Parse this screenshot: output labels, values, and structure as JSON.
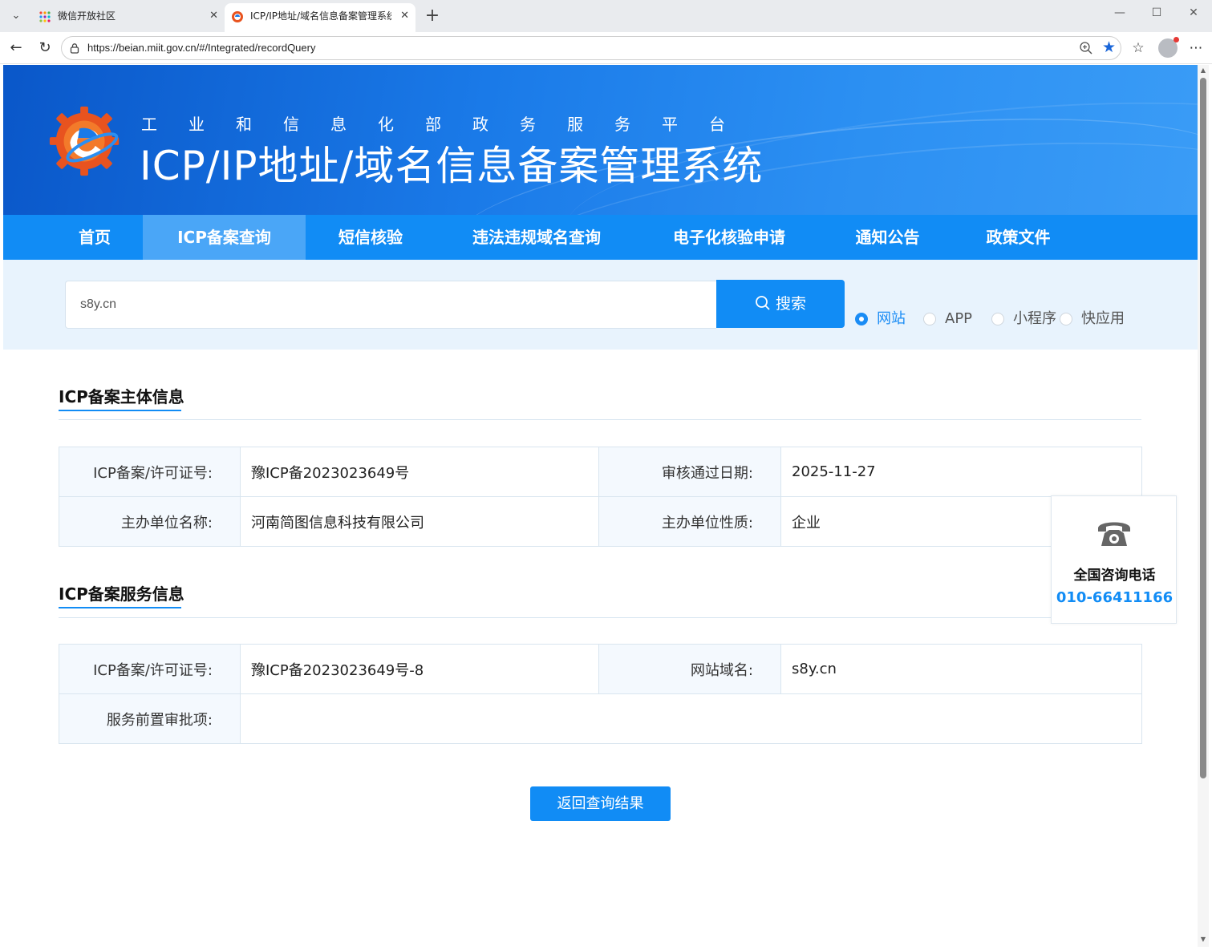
{
  "browser": {
    "tabs": [
      {
        "title": "微信开放社区",
        "active": false
      },
      {
        "title": "ICP/IP地址/域名信息备案管理系统",
        "active": true
      }
    ],
    "url": "https://beian.miit.gov.cn/#/Integrated/recordQuery"
  },
  "header": {
    "subtitle": "工业和信息化部政务服务平台",
    "title": "ICP/IP地址/域名信息备案管理系统"
  },
  "menu": {
    "items": [
      {
        "label": "首页",
        "active": false
      },
      {
        "label": "ICP备案查询",
        "active": true
      },
      {
        "label": "短信核验",
        "active": false
      },
      {
        "label": "违法违规域名查询",
        "active": false
      },
      {
        "label": "电子化核验申请",
        "active": false
      },
      {
        "label": "通知公告",
        "active": false
      },
      {
        "label": "政策文件",
        "active": false
      }
    ]
  },
  "search": {
    "value": "s8y.cn",
    "button_label": "搜索",
    "types": [
      {
        "label": "网站",
        "checked": true
      },
      {
        "label": "APP",
        "checked": false
      },
      {
        "label": "小程序",
        "checked": false
      },
      {
        "label": "快应用",
        "checked": false
      }
    ]
  },
  "subject_info": {
    "title": "ICP备案主体信息",
    "license_label": "ICP备案/许可证号:",
    "license_value": "豫ICP备2023023649号",
    "approve_date_label": "审核通过日期:",
    "approve_date_value": "2025-11-27",
    "org_name_label": "主办单位名称:",
    "org_name_value": "河南简图信息科技有限公司",
    "org_type_label": "主办单位性质:",
    "org_type_value": "企业"
  },
  "service_info": {
    "title": "ICP备案服务信息",
    "license_label": "ICP备案/许可证号:",
    "license_value": "豫ICP备2023023649号-8",
    "domain_label": "网站域名:",
    "domain_value": "s8y.cn",
    "preapproval_label": "服务前置审批项:",
    "preapproval_value": ""
  },
  "return_button": "返回查询结果",
  "hotline": {
    "label": "全国咨询电话",
    "number": "010-66411166"
  },
  "colors": {
    "primary": "#118cf5",
    "menu_active": "#4aa6f7",
    "search_bg": "#e8f3fd",
    "label_cell_bg": "#f4f9fe"
  }
}
